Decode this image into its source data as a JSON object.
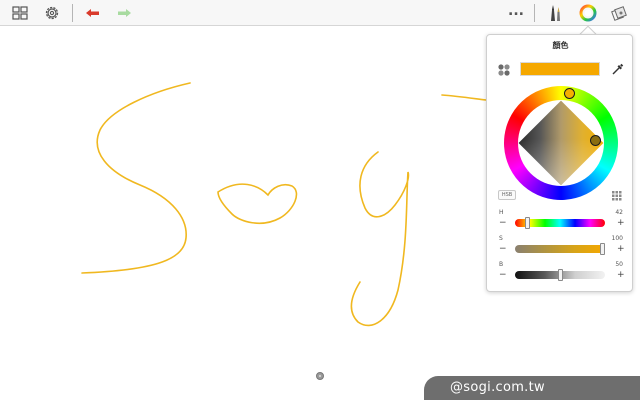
{
  "toolbar": {
    "icons": {
      "gallery": "grid-icon",
      "settings": "gear-icon",
      "undo": "undo-arrow-icon",
      "redo": "redo-arrow-icon",
      "more": "more-icon",
      "brush_library": "brushes-icon",
      "color": "color-wheel-icon",
      "layers": "layers-icon"
    },
    "more_label": "..."
  },
  "color_panel": {
    "title": "顏色",
    "mode_button": "HSB",
    "current_color": "#f5a800",
    "hue_deg": 42,
    "sliders": [
      {
        "key": "H",
        "label": "H",
        "value": "42",
        "fraction": 0.12
      },
      {
        "key": "S",
        "label": "S",
        "value": "100",
        "fraction": 1.0
      },
      {
        "key": "B",
        "label": "B",
        "value": "50",
        "fraction": 0.5
      }
    ],
    "minus": "−",
    "plus": "+"
  },
  "canvas": {
    "stroke_color": "#f0b820",
    "strokes": [
      "S",
      "o",
      "g",
      "i"
    ]
  },
  "watermark": {
    "text": "@sogi.com.tw"
  },
  "colors": {
    "undo": "#d93a2b",
    "redo": "#a8dba0",
    "accent": "#f5a800"
  }
}
